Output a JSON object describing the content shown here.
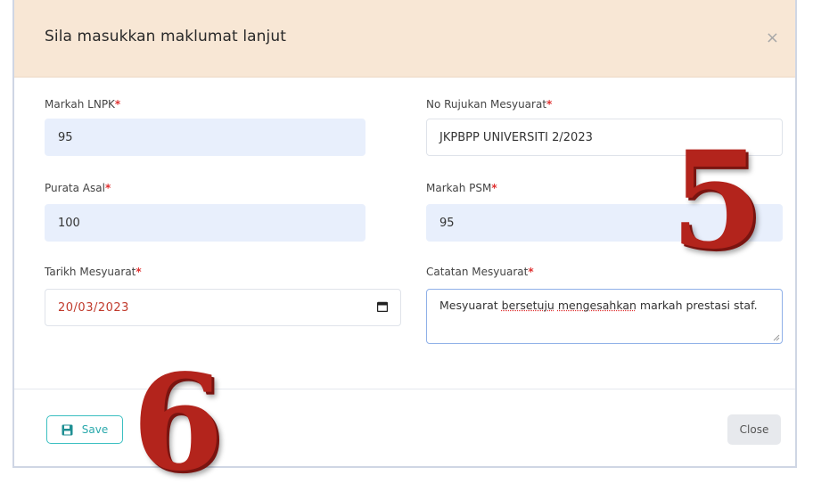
{
  "dialog": {
    "title": "Sila masukkan maklumat lanjut",
    "close_glyph": "×"
  },
  "fields": {
    "markah_lnpk": {
      "label": "Markah LNPK",
      "value": "95"
    },
    "no_rujukan": {
      "label": "No Rujukan Mesyuarat",
      "value": "JKPBPP UNIVERSITI 2/2023"
    },
    "purata_asal": {
      "label": "Purata Asal",
      "value": "100"
    },
    "markah_psm": {
      "label": "Markah PSM",
      "value": "95"
    },
    "tarikh": {
      "label": "Tarikh Mesyuarat",
      "value": "20/03/2023"
    },
    "catatan": {
      "label": "Catatan Mesyuarat",
      "value_part1": "Mesyuarat ",
      "value_part2": "bersetuju",
      "value_part3": " ",
      "value_part4": "mengesahkan",
      "value_part5": " markah prestasi staf."
    }
  },
  "required_marker": "*",
  "footer": {
    "save_label": "Save",
    "close_label": "Close"
  },
  "overlays": {
    "annotation_5": "5",
    "annotation_6": "6"
  },
  "colors": {
    "header_bg": "#f8e7d5",
    "filled_input_bg": "#e8effc",
    "save_accent": "#3bbfc1",
    "required": "#e03131",
    "annotation": "#b3241c"
  },
  "icons": {
    "save": "floppy-disk-icon",
    "calendar": "calendar-icon",
    "close": "close-icon"
  }
}
